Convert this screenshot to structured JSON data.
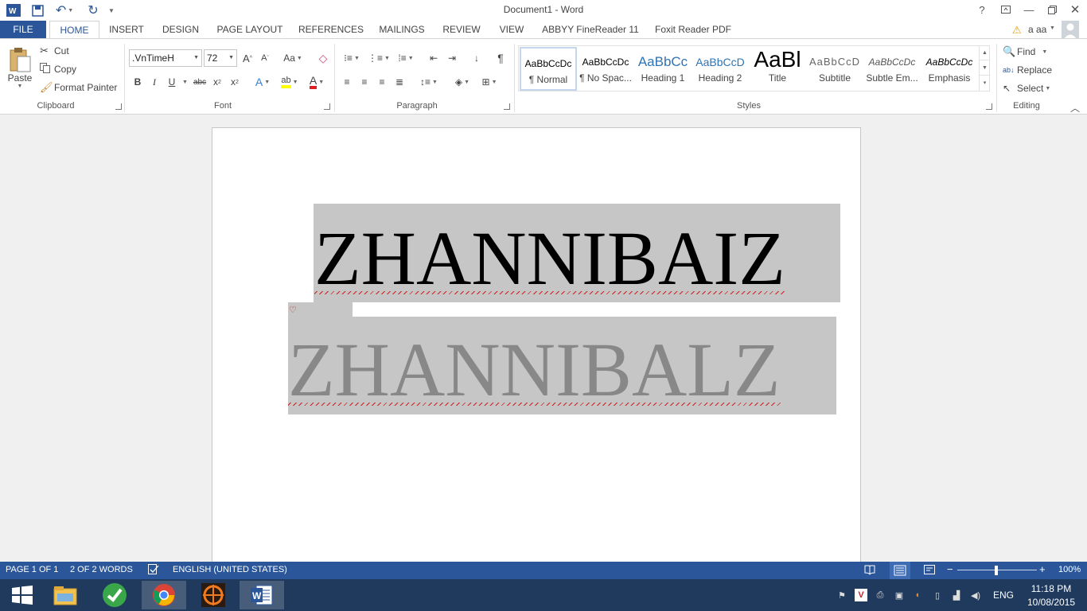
{
  "window": {
    "title": "Document1 - Word",
    "help": "?",
    "user_name": "a aa"
  },
  "tabs": {
    "file": "FILE",
    "home": "HOME",
    "insert": "INSERT",
    "design": "DESIGN",
    "page_layout": "PAGE LAYOUT",
    "references": "REFERENCES",
    "mailings": "MAILINGS",
    "review": "REVIEW",
    "view": "VIEW",
    "abbyy": "ABBYY FineReader 11",
    "foxit": "Foxit Reader PDF"
  },
  "clipboard": {
    "paste": "Paste",
    "cut": "Cut",
    "copy": "Copy",
    "format_painter": "Format Painter",
    "label": "Clipboard"
  },
  "font": {
    "name": ".VnTimeH",
    "size": "72",
    "change_case": "Aa",
    "bold": "B",
    "italic": "I",
    "underline": "U",
    "strike": "abc",
    "subscript": "x",
    "superscript": "x",
    "text_effects": "A",
    "highlight": "ab",
    "font_color": "A",
    "grow": "A",
    "shrink": "A",
    "label": "Font"
  },
  "paragraph": {
    "label": "Paragraph",
    "pilcrow": "¶"
  },
  "styles": {
    "label": "Styles",
    "items": [
      {
        "sample": "AaBbCcDc",
        "name": "¶ Normal"
      },
      {
        "sample": "AaBbCcDc",
        "name": "¶ No Spac..."
      },
      {
        "sample": "AaBbCc",
        "name": "Heading 1"
      },
      {
        "sample": "AaBbCcD",
        "name": "Heading 2"
      },
      {
        "sample": "AaBl",
        "name": "Title"
      },
      {
        "sample": "AaBbCcD",
        "name": "Subtitle"
      },
      {
        "sample": "AaBbCcDc",
        "name": "Subtle Em..."
      },
      {
        "sample": "AaBbCcDc",
        "name": "Emphasis"
      }
    ]
  },
  "editing": {
    "find": "Find",
    "replace": "Replace",
    "select": "Select",
    "label": "Editing"
  },
  "document": {
    "line1": "ZHANNIBAIZ",
    "line2": "ZHANNIBALZ"
  },
  "status": {
    "page": "PAGE 1 OF 1",
    "words": "2 OF 2 WORDS",
    "language": "ENGLISH (UNITED STATES)",
    "zoom": "100%",
    "zoom_minus": "−",
    "zoom_plus": "+"
  },
  "taskbar": {
    "lang": "ENG",
    "time": "11:18 PM",
    "date": "10/08/2015"
  },
  "colors": {
    "accent": "#2b579a",
    "selection": "#c6c6c6"
  }
}
